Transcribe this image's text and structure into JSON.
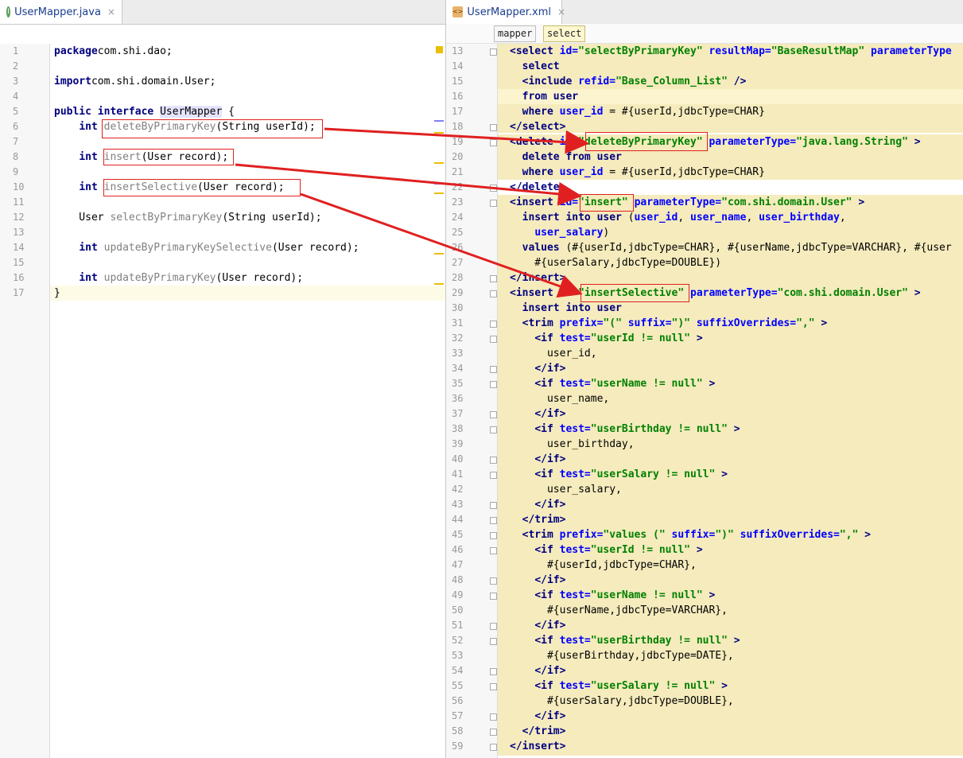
{
  "left_tab": {
    "icon": "java-class-icon",
    "icon_glyph": "I",
    "label": "UserMapper.java",
    "close": "×"
  },
  "right_tab": {
    "icon": "xml-file-icon",
    "icon_glyph": "<>",
    "label": "UserMapper.xml",
    "close": "×"
  },
  "breadcrumb": [
    "mapper",
    "select"
  ],
  "java_lines": [
    {
      "n": "1",
      "parts": [
        [
          "kw",
          "package"
        ],
        [
          "",
          "com.shi.dao;"
        ]
      ]
    },
    {
      "n": "2",
      "parts": []
    },
    {
      "n": "3",
      "parts": [
        [
          "kw",
          "import"
        ],
        [
          "",
          "com.shi.domain.User;"
        ]
      ]
    },
    {
      "n": "4",
      "parts": []
    },
    {
      "n": "5",
      "parts": [
        [
          "kw",
          "public interface "
        ],
        [
          "hl",
          "UserMapper"
        ],
        [
          "",
          " {"
        ]
      ]
    },
    {
      "n": "6",
      "parts": [
        [
          "",
          "    "
        ],
        [
          "kw",
          "int "
        ],
        [
          "gray",
          "deleteByPrimaryKey"
        ],
        [
          "",
          "(String userId);"
        ]
      ]
    },
    {
      "n": "7",
      "parts": []
    },
    {
      "n": "8",
      "parts": [
        [
          "",
          "    "
        ],
        [
          "kw",
          "int "
        ],
        [
          "gray",
          "insert"
        ],
        [
          "",
          "(User record);"
        ]
      ]
    },
    {
      "n": "9",
      "parts": []
    },
    {
      "n": "10",
      "parts": [
        [
          "",
          "    "
        ],
        [
          "kw",
          "int "
        ],
        [
          "gray",
          "insertSelective"
        ],
        [
          "",
          "(User record);"
        ]
      ]
    },
    {
      "n": "11",
      "parts": []
    },
    {
      "n": "12",
      "parts": [
        [
          "",
          "    User "
        ],
        [
          "gray",
          "selectByPrimaryKey"
        ],
        [
          "",
          "(String userId);"
        ]
      ]
    },
    {
      "n": "13",
      "parts": []
    },
    {
      "n": "14",
      "parts": [
        [
          "",
          "    "
        ],
        [
          "kw",
          "int "
        ],
        [
          "gray",
          "updateByPrimaryKeySelective"
        ],
        [
          "",
          "(User record);"
        ]
      ]
    },
    {
      "n": "15",
      "parts": []
    },
    {
      "n": "16",
      "parts": [
        [
          "",
          "    "
        ],
        [
          "kw",
          "int "
        ],
        [
          "gray",
          "updateByPrimaryKey"
        ],
        [
          "",
          "(User record);"
        ]
      ]
    },
    {
      "n": "17",
      "parts": [
        [
          "",
          "}"
        ]
      ]
    }
  ],
  "xml_lines": [
    {
      "n": "13",
      "parts": [
        [
          "tag",
          "<select "
        ],
        [
          "attr",
          "id="
        ],
        [
          "str",
          "\"selectByPrimaryKey\" "
        ],
        [
          "attr",
          "resultMap="
        ],
        [
          "str",
          "\"BaseResultMap\" "
        ],
        [
          "attr",
          "parameterType"
        ]
      ]
    },
    {
      "n": "14",
      "parts": [
        [
          "",
          "  "
        ],
        [
          "kw",
          "select"
        ]
      ]
    },
    {
      "n": "15",
      "parts": [
        [
          "",
          "  "
        ],
        [
          "tag",
          "<include "
        ],
        [
          "attr",
          "refid="
        ],
        [
          "str",
          "\"Base_Column_List\" "
        ],
        [
          "tag",
          "/>"
        ]
      ]
    },
    {
      "n": "16",
      "parts": [
        [
          "",
          "  "
        ],
        [
          "kw",
          "from user"
        ]
      ]
    },
    {
      "n": "17",
      "parts": [
        [
          "",
          "  "
        ],
        [
          "kw",
          "where "
        ],
        [
          "attr",
          "user_id"
        ],
        [
          "",
          " = #{userId,jdbcType=CHAR}"
        ]
      ]
    },
    {
      "n": "18",
      "parts": [
        [
          "tag",
          "</select>"
        ]
      ]
    },
    {
      "n": "19",
      "parts": [
        [
          "tag",
          "<delete "
        ],
        [
          "attr",
          "id="
        ],
        [
          "str",
          "\"deleteByPrimaryKey\" "
        ],
        [
          "attr",
          "parameterType="
        ],
        [
          "str",
          "\"java.lang.String\" "
        ],
        [
          "tag",
          ">"
        ]
      ]
    },
    {
      "n": "20",
      "parts": [
        [
          "",
          "  "
        ],
        [
          "kw",
          "delete from user"
        ]
      ]
    },
    {
      "n": "21",
      "parts": [
        [
          "",
          "  "
        ],
        [
          "kw",
          "where "
        ],
        [
          "attr",
          "user_id"
        ],
        [
          "",
          " = #{userId,jdbcType=CHAR}"
        ]
      ]
    },
    {
      "n": "22",
      "parts": [
        [
          "tag",
          "</delete>"
        ]
      ]
    },
    {
      "n": "23",
      "parts": [
        [
          "tag",
          "<insert "
        ],
        [
          "attr",
          "id="
        ],
        [
          "str",
          "\"insert\" "
        ],
        [
          "attr",
          "parameterType="
        ],
        [
          "str",
          "\"com.shi.domain.User\" "
        ],
        [
          "tag",
          ">"
        ]
      ]
    },
    {
      "n": "24",
      "parts": [
        [
          "",
          "  "
        ],
        [
          "kw",
          "insert into user "
        ],
        [
          "",
          "("
        ],
        [
          "attr",
          "user_id"
        ],
        [
          "",
          ", "
        ],
        [
          "attr",
          "user_name"
        ],
        [
          "",
          ", "
        ],
        [
          "attr",
          "user_birthday"
        ],
        [
          "",
          ","
        ]
      ]
    },
    {
      "n": "25",
      "parts": [
        [
          "",
          "    "
        ],
        [
          "attr",
          "user_salary"
        ],
        [
          "",
          ")"
        ]
      ]
    },
    {
      "n": "26",
      "parts": [
        [
          "",
          "  "
        ],
        [
          "kw",
          "values "
        ],
        [
          "",
          "(#{userId,jdbcType=CHAR}, #{userName,jdbcType=VARCHAR}, #{user"
        ]
      ]
    },
    {
      "n": "27",
      "parts": [
        [
          "",
          "    #{userSalary,jdbcType=DOUBLE})"
        ]
      ]
    },
    {
      "n": "28",
      "parts": [
        [
          "tag",
          "</insert>"
        ]
      ]
    },
    {
      "n": "29",
      "parts": [
        [
          "tag",
          "<insert "
        ],
        [
          "attr",
          "id="
        ],
        [
          "str",
          "\"insertSelective\" "
        ],
        [
          "attr",
          "parameterType="
        ],
        [
          "str",
          "\"com.shi.domain.User\" "
        ],
        [
          "tag",
          ">"
        ]
      ]
    },
    {
      "n": "30",
      "parts": [
        [
          "",
          "  "
        ],
        [
          "kw",
          "insert into user"
        ]
      ]
    },
    {
      "n": "31",
      "parts": [
        [
          "",
          "  "
        ],
        [
          "tag",
          "<trim "
        ],
        [
          "attr",
          "prefix="
        ],
        [
          "str",
          "\"(\" "
        ],
        [
          "attr",
          "suffix="
        ],
        [
          "str",
          "\")\" "
        ],
        [
          "attr",
          "suffixOverrides="
        ],
        [
          "str",
          "\",\" "
        ],
        [
          "tag",
          ">"
        ]
      ]
    },
    {
      "n": "32",
      "parts": [
        [
          "",
          "    "
        ],
        [
          "tag",
          "<if "
        ],
        [
          "attr",
          "test="
        ],
        [
          "str",
          "\"userId != null\" "
        ],
        [
          "tag",
          ">"
        ]
      ]
    },
    {
      "n": "33",
      "parts": [
        [
          "",
          "      user_id,"
        ]
      ]
    },
    {
      "n": "34",
      "parts": [
        [
          "",
          "    "
        ],
        [
          "tag",
          "</if>"
        ]
      ]
    },
    {
      "n": "35",
      "parts": [
        [
          "",
          "    "
        ],
        [
          "tag",
          "<if "
        ],
        [
          "attr",
          "test="
        ],
        [
          "str",
          "\"userName != null\" "
        ],
        [
          "tag",
          ">"
        ]
      ]
    },
    {
      "n": "36",
      "parts": [
        [
          "",
          "      user_name,"
        ]
      ]
    },
    {
      "n": "37",
      "parts": [
        [
          "",
          "    "
        ],
        [
          "tag",
          "</if>"
        ]
      ]
    },
    {
      "n": "38",
      "parts": [
        [
          "",
          "    "
        ],
        [
          "tag",
          "<if "
        ],
        [
          "attr",
          "test="
        ],
        [
          "str",
          "\"userBirthday != null\" "
        ],
        [
          "tag",
          ">"
        ]
      ]
    },
    {
      "n": "39",
      "parts": [
        [
          "",
          "      user_birthday,"
        ]
      ]
    },
    {
      "n": "40",
      "parts": [
        [
          "",
          "    "
        ],
        [
          "tag",
          "</if>"
        ]
      ]
    },
    {
      "n": "41",
      "parts": [
        [
          "",
          "    "
        ],
        [
          "tag",
          "<if "
        ],
        [
          "attr",
          "test="
        ],
        [
          "str",
          "\"userSalary != null\" "
        ],
        [
          "tag",
          ">"
        ]
      ]
    },
    {
      "n": "42",
      "parts": [
        [
          "",
          "      user_salary,"
        ]
      ]
    },
    {
      "n": "43",
      "parts": [
        [
          "",
          "    "
        ],
        [
          "tag",
          "</if>"
        ]
      ]
    },
    {
      "n": "44",
      "parts": [
        [
          "",
          "  "
        ],
        [
          "tag",
          "</trim>"
        ]
      ]
    },
    {
      "n": "45",
      "parts": [
        [
          "",
          "  "
        ],
        [
          "tag",
          "<trim "
        ],
        [
          "attr",
          "prefix="
        ],
        [
          "str",
          "\"values (\" "
        ],
        [
          "attr",
          "suffix="
        ],
        [
          "str",
          "\")\" "
        ],
        [
          "attr",
          "suffixOverrides="
        ],
        [
          "str",
          "\",\" "
        ],
        [
          "tag",
          ">"
        ]
      ]
    },
    {
      "n": "46",
      "parts": [
        [
          "",
          "    "
        ],
        [
          "tag",
          "<if "
        ],
        [
          "attr",
          "test="
        ],
        [
          "str",
          "\"userId != null\" "
        ],
        [
          "tag",
          ">"
        ]
      ]
    },
    {
      "n": "47",
      "parts": [
        [
          "",
          "      #{userId,jdbcType=CHAR},"
        ]
      ]
    },
    {
      "n": "48",
      "parts": [
        [
          "",
          "    "
        ],
        [
          "tag",
          "</if>"
        ]
      ]
    },
    {
      "n": "49",
      "parts": [
        [
          "",
          "    "
        ],
        [
          "tag",
          "<if "
        ],
        [
          "attr",
          "test="
        ],
        [
          "str",
          "\"userName != null\" "
        ],
        [
          "tag",
          ">"
        ]
      ]
    },
    {
      "n": "50",
      "parts": [
        [
          "",
          "      #{userName,jdbcType=VARCHAR},"
        ]
      ]
    },
    {
      "n": "51",
      "parts": [
        [
          "",
          "    "
        ],
        [
          "tag",
          "</if>"
        ]
      ]
    },
    {
      "n": "52",
      "parts": [
        [
          "",
          "    "
        ],
        [
          "tag",
          "<if "
        ],
        [
          "attr",
          "test="
        ],
        [
          "str",
          "\"userBirthday != null\" "
        ],
        [
          "tag",
          ">"
        ]
      ]
    },
    {
      "n": "53",
      "parts": [
        [
          "",
          "      #{userBirthday,jdbcType=DATE},"
        ]
      ]
    },
    {
      "n": "54",
      "parts": [
        [
          "",
          "    "
        ],
        [
          "tag",
          "</if>"
        ]
      ]
    },
    {
      "n": "55",
      "parts": [
        [
          "",
          "    "
        ],
        [
          "tag",
          "<if "
        ],
        [
          "attr",
          "test="
        ],
        [
          "str",
          "\"userSalary != null\" "
        ],
        [
          "tag",
          ">"
        ]
      ]
    },
    {
      "n": "56",
      "parts": [
        [
          "",
          "      #{userSalary,jdbcType=DOUBLE},"
        ]
      ]
    },
    {
      "n": "57",
      "parts": [
        [
          "",
          "    "
        ],
        [
          "tag",
          "</if>"
        ]
      ]
    },
    {
      "n": "58",
      "parts": [
        [
          "",
          "  "
        ],
        [
          "tag",
          "</trim>"
        ]
      ]
    },
    {
      "n": "59",
      "parts": [
        [
          "tag",
          "</insert>"
        ]
      ]
    }
  ],
  "colors": {
    "highlight_band": "#f5ebbd",
    "arrow": "#e02020",
    "gutter_warning": "#e8c000"
  }
}
